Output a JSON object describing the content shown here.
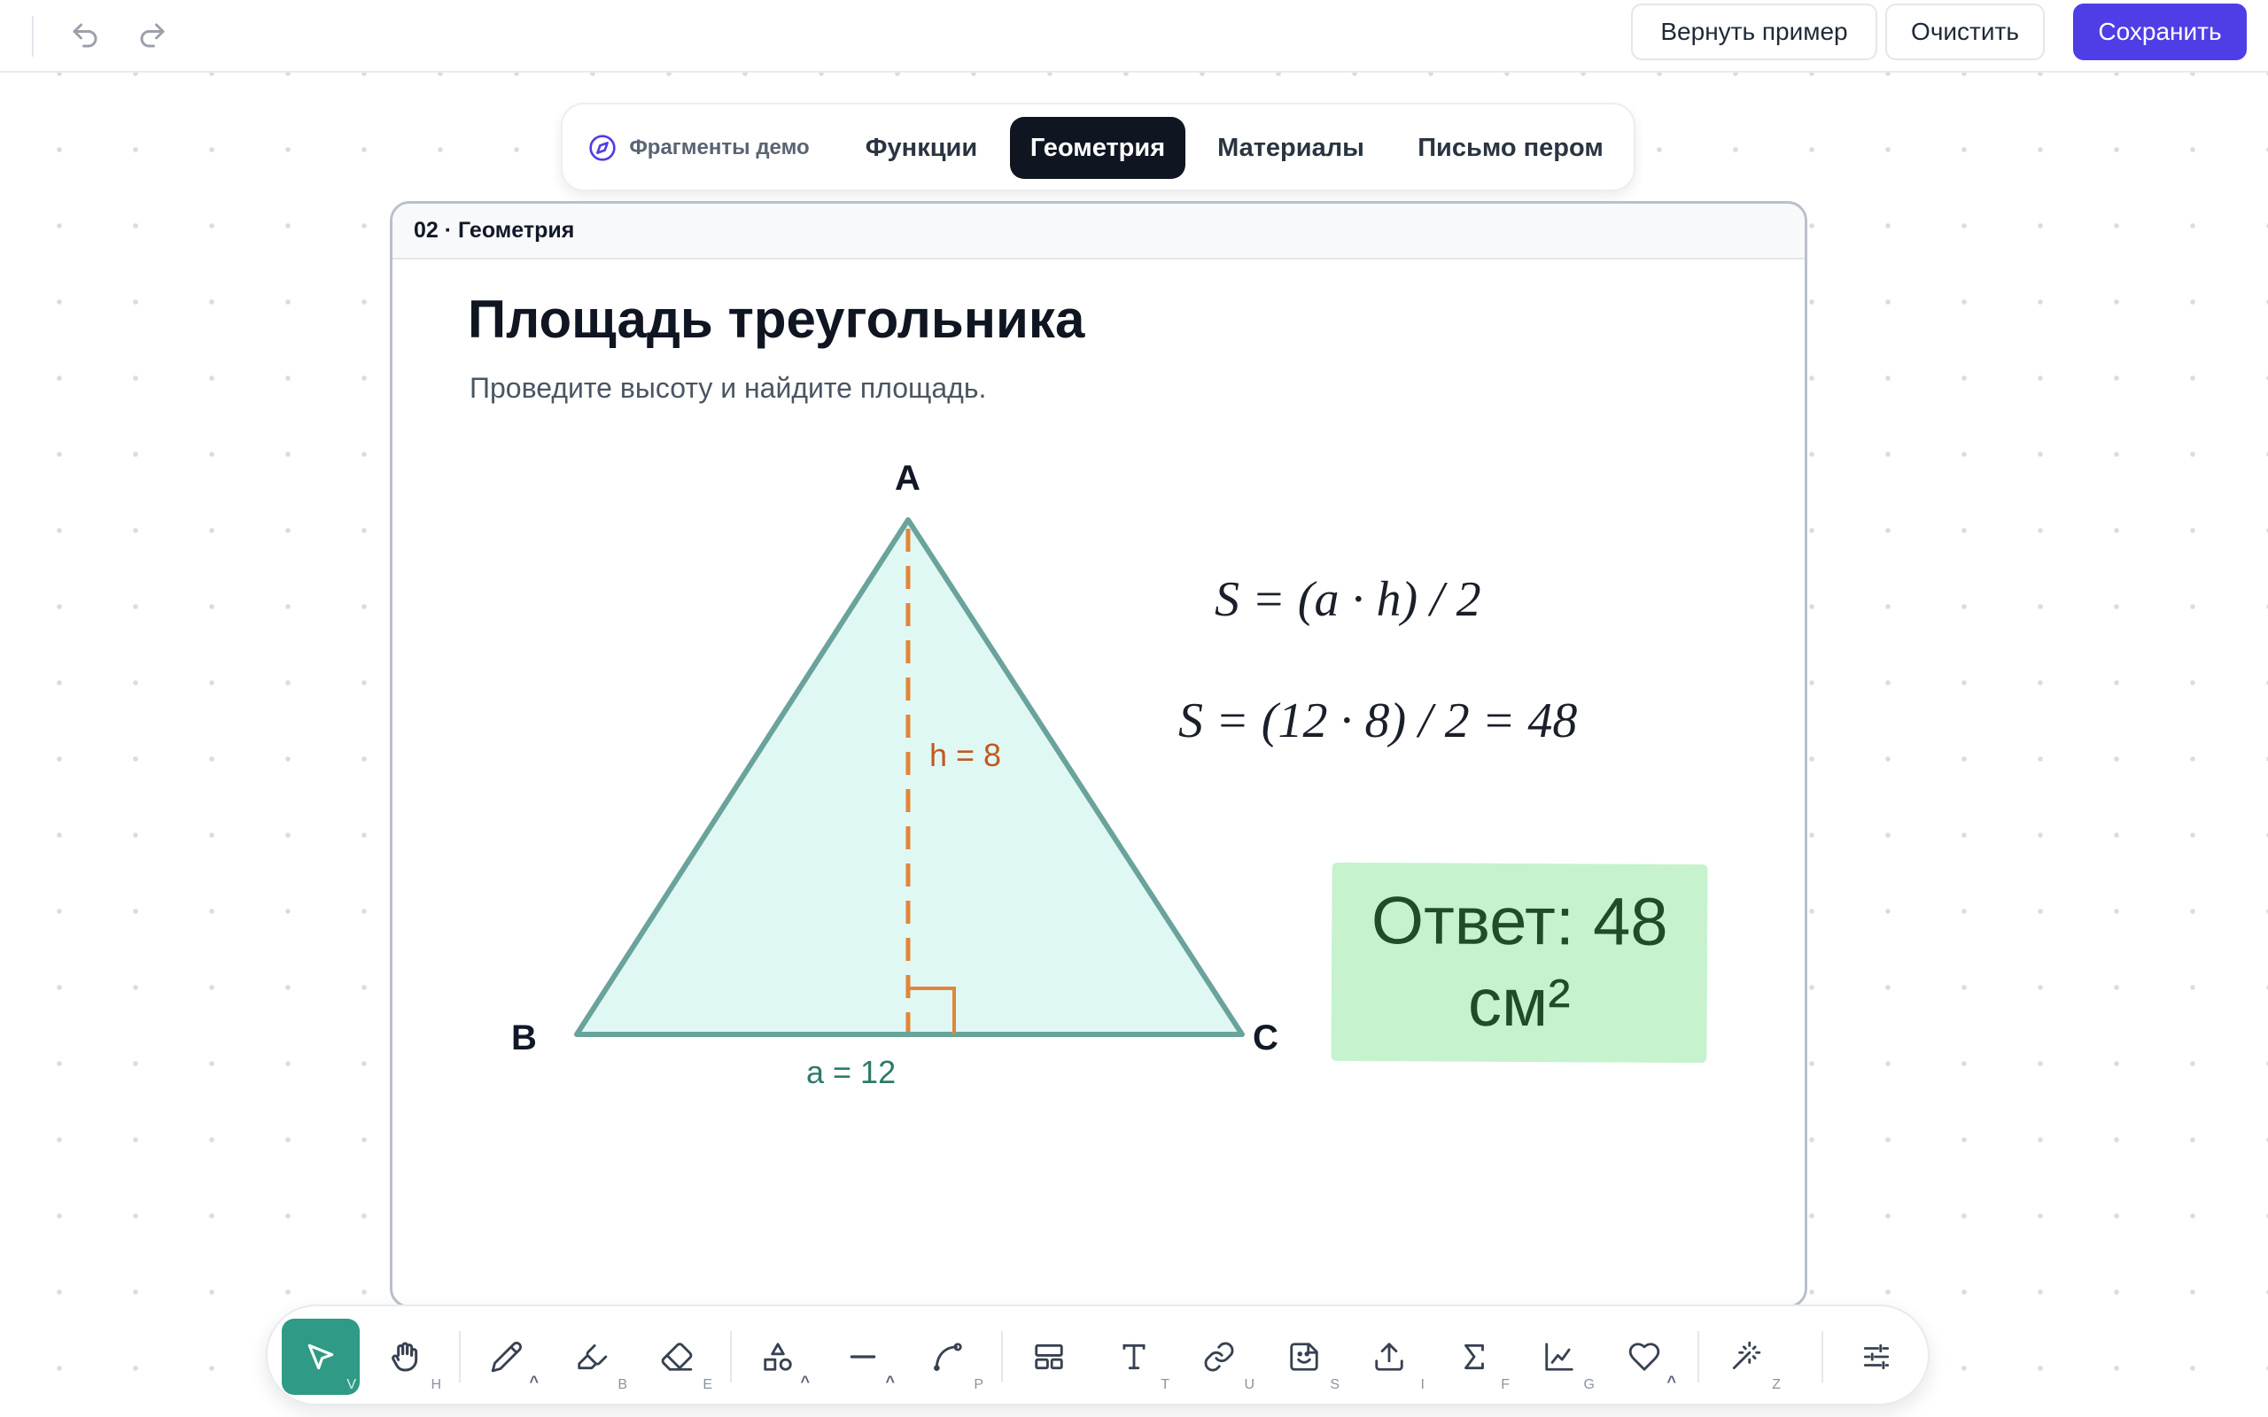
{
  "topbar": {
    "restore_label": "Вернуть пример",
    "clear_label": "Очистить",
    "save_label": "Сохранить"
  },
  "tabs": {
    "demo_label": "Фрагменты демо",
    "items": [
      {
        "label": "Функции",
        "active": false
      },
      {
        "label": "Геометрия",
        "active": true
      },
      {
        "label": "Материалы",
        "active": false
      },
      {
        "label": "Письмо пером",
        "active": false
      }
    ]
  },
  "card": {
    "header": "02 · Геометрия",
    "title": "Площадь треугольника",
    "subtitle": "Проведите высоту и найдите площадь.",
    "vertices": {
      "a": "A",
      "b": "B",
      "c": "C"
    },
    "height_label": "h = 8",
    "base_label": "a = 12",
    "formula_1": "S = (a · h) / 2",
    "formula_2": "S = (12 · 8) / 2 = 48",
    "answer": "Ответ: 48 см²"
  },
  "colors": {
    "accent": "#4f3ee6",
    "active_tool": "#2f9a86",
    "triangle_fill": "#e0f8f4",
    "triangle_stroke": "#6aa39b",
    "height_line": "#e0863a",
    "answer_bg": "#c6f3cd"
  },
  "toolbar": {
    "tools": [
      {
        "icon": "select-arrow-icon",
        "key": "V",
        "active": true
      },
      {
        "icon": "hand-icon",
        "key": "H"
      },
      {
        "icon": "pencil-icon",
        "key": ""
      },
      {
        "icon": "highlighter-icon",
        "key": "B"
      },
      {
        "icon": "eraser-icon",
        "key": "E"
      },
      {
        "icon": "shapes-icon",
        "key": ""
      },
      {
        "icon": "line-icon",
        "key": ""
      },
      {
        "icon": "curve-icon",
        "key": "P"
      },
      {
        "icon": "layout-icon",
        "key": ""
      },
      {
        "icon": "text-icon",
        "key": "T"
      },
      {
        "icon": "link-icon",
        "key": "U"
      },
      {
        "icon": "sticker-icon",
        "key": "S"
      },
      {
        "icon": "upload-icon",
        "key": "I"
      },
      {
        "icon": "sigma-icon",
        "key": "F"
      },
      {
        "icon": "graph-icon",
        "key": "G"
      },
      {
        "icon": "heart-icon",
        "key": ""
      },
      {
        "icon": "magic-wand-icon",
        "key": "Z"
      },
      {
        "icon": "settings-sliders-icon",
        "key": ""
      }
    ]
  }
}
